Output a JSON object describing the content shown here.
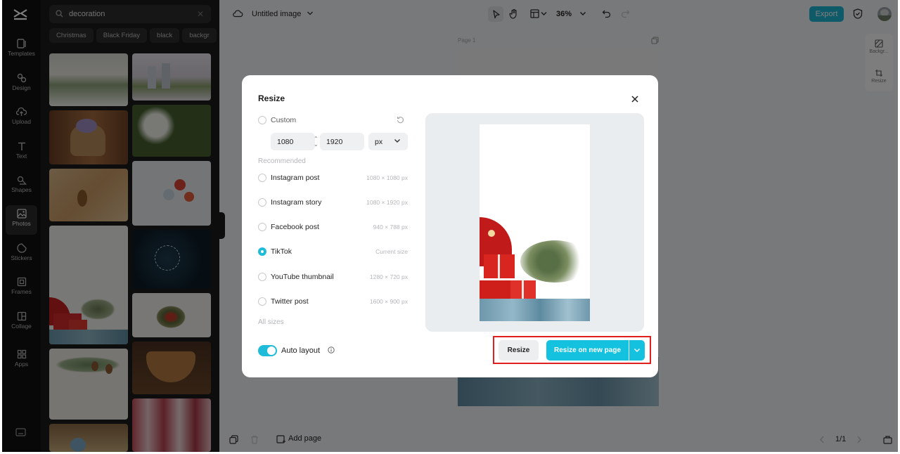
{
  "nav": {
    "items": [
      {
        "label": "Templates",
        "icon": "templates-icon"
      },
      {
        "label": "Design",
        "icon": "design-icon"
      },
      {
        "label": "Upload",
        "icon": "upload-icon"
      },
      {
        "label": "Text",
        "icon": "text-icon"
      },
      {
        "label": "Shapes",
        "icon": "shapes-icon"
      },
      {
        "label": "Photos",
        "icon": "photos-icon",
        "active": true
      },
      {
        "label": "Stickers",
        "icon": "stickers-icon"
      },
      {
        "label": "Frames",
        "icon": "frames-icon"
      },
      {
        "label": "Collage",
        "icon": "collage-icon"
      },
      {
        "label": "Apps",
        "icon": "apps-icon"
      }
    ]
  },
  "panel": {
    "search_value": "decoration",
    "chips": [
      "Christmas",
      "Black Friday",
      "black",
      "backgr"
    ]
  },
  "topbar": {
    "title": "Untitled image",
    "zoom": "36%",
    "export_label": "Export"
  },
  "canvas": {
    "page_label": "Page 1",
    "right_tools": [
      "Backgr...",
      "Resize"
    ]
  },
  "bottombar": {
    "add_page": "Add page",
    "page_count": "1/1"
  },
  "modal": {
    "title": "Resize",
    "custom_label": "Custom",
    "width_value": "1080",
    "height_value": "1920",
    "unit": "px",
    "recommended_label": "Recommended",
    "options": [
      {
        "label": "Instagram post",
        "size": "1080 × 1080 px"
      },
      {
        "label": "Instagram story",
        "size": "1080 × 1920 px"
      },
      {
        "label": "Facebook post",
        "size": "940 × 788 px"
      },
      {
        "label": "TikTok",
        "size": "Current size",
        "selected": true
      },
      {
        "label": "YouTube thumbnail",
        "size": "1280 × 720 px"
      },
      {
        "label": "Twitter post",
        "size": "1600 × 900 px"
      }
    ],
    "all_sizes_label": "All sizes",
    "auto_layout_label": "Auto layout",
    "auto_layout_on": true,
    "resize_button": "Resize",
    "resize_new_page_button": "Resize on new page"
  },
  "colors": {
    "accent": "#14c2df",
    "highlight": "#e02020"
  }
}
